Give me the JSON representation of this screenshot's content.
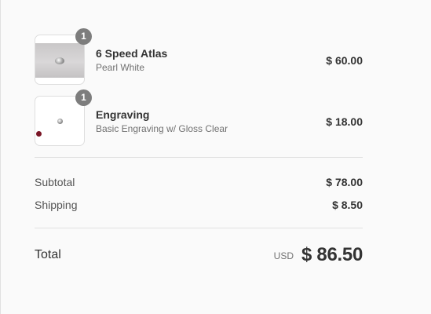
{
  "order_summary": {
    "items": [
      {
        "quantity": "1",
        "name": "6 Speed Atlas",
        "variant": "Pearl White",
        "price": "$ 60.00",
        "thumbnail": "product-photo-ring"
      },
      {
        "quantity": "1",
        "name": "Engraving",
        "variant": "Basic Engraving w/ Gloss Clear",
        "price": "$ 18.00",
        "thumbnail": "product-photo-engraving"
      }
    ],
    "subtotal": {
      "label": "Subtotal",
      "value": "$ 78.00"
    },
    "shipping": {
      "label": "Shipping",
      "value": "$ 8.50"
    },
    "total": {
      "label": "Total",
      "currency": "USD",
      "value": "$ 86.50"
    }
  },
  "colors": {
    "background": "#fafafa",
    "text": "#333333",
    "muted_text": "#717171",
    "badge": "#7d7d7d",
    "divider": "#e1e1e1"
  }
}
